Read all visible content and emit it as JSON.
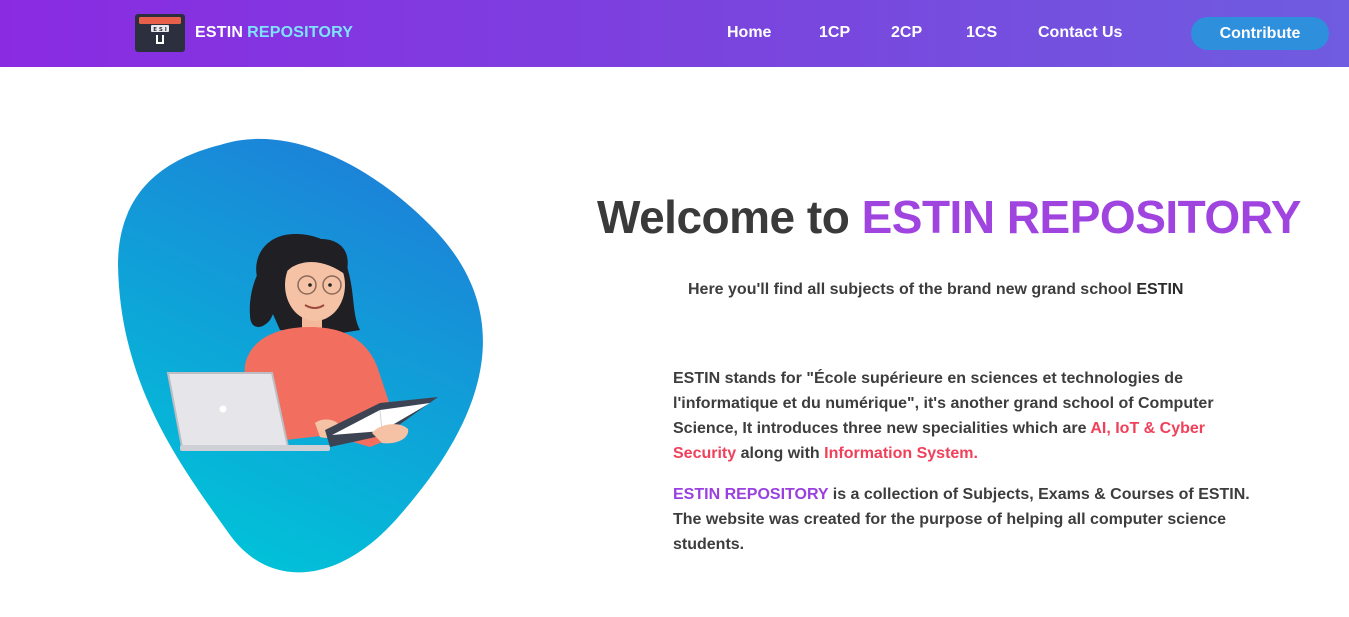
{
  "header": {
    "brand_primary": "ESTIN",
    "brand_secondary": "REPOSITORY",
    "logo_icon": "archive-box-icon",
    "nav": [
      {
        "label": "Home"
      },
      {
        "label": "1CP"
      },
      {
        "label": "2CP"
      },
      {
        "label": "1CS"
      },
      {
        "label": "Contact Us"
      }
    ],
    "contribute_label": "Contribute"
  },
  "hero": {
    "title_prefix": "Welcome to",
    "title_accent": "ESTIN REPOSITORY",
    "subtitle_prefix": "Here you'll find all subjects of the brand new grand school",
    "subtitle_strong": "ESTIN",
    "illustration": "woman-studying-laptop-book-illustration"
  },
  "about": {
    "p1_text": "ESTIN stands for \"École supérieure en sciences et technologies de l'informatique et du numérique\", it's another grand school of Computer Science, It introduces three new specialities which are",
    "p1_specialities": "AI, IoT & Cyber Security",
    "p1_mid": "along with",
    "p1_info": "Information System.",
    "p2_brand": "ESTIN REPOSITORY",
    "p2_text": "is a collection of Subjects, Exams & Courses of ESTIN. The website was created for the purpose of helping all computer science students."
  },
  "colors": {
    "navbar_start": "#8a2be2",
    "navbar_end": "#6f5ce0",
    "button": "#2e8fdd",
    "accent_purple": "#a044e0",
    "accent_red": "#f0405a",
    "brand_cyan": "#7fe3ff",
    "blob_top": "#1e7fd8",
    "blob_bottom": "#00c4d8"
  }
}
